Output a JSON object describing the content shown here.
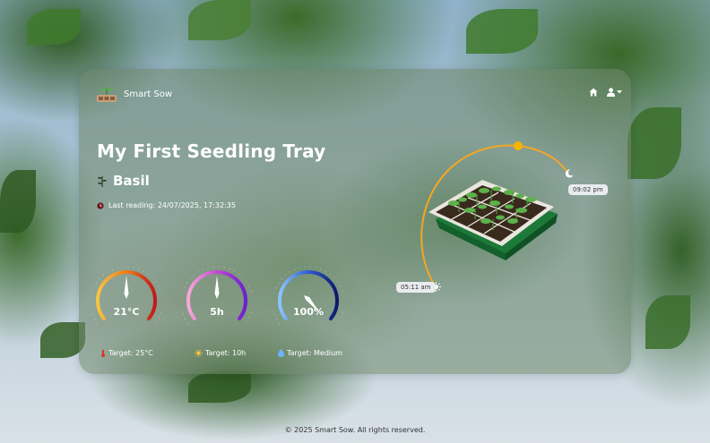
{
  "brand": {
    "name": "Smart Sow"
  },
  "nav": {
    "home_icon": "home-icon",
    "user_icon": "user-icon"
  },
  "tray": {
    "title": "My First Seedling Tray",
    "plant": "Basil",
    "last_reading": "Last reading: 24/07/2025, 17:32:35"
  },
  "gauges": [
    {
      "name": "temperature",
      "value": "21°C",
      "target": "Target: 25°C",
      "colors": [
        "#f5c542",
        "#f07c1a",
        "#c0191b"
      ]
    },
    {
      "name": "light",
      "value": "5h",
      "target": "Target: 10h",
      "colors": [
        "#f7a8d8",
        "#c14ad0",
        "#6a1fd0"
      ]
    },
    {
      "name": "humidity",
      "value": "100%",
      "target": "Target: Medium",
      "colors": [
        "#8ec5ff",
        "#2f5bd3",
        "#0d1a6b"
      ]
    }
  ],
  "sun_arc": {
    "sunrise": "05:11 am",
    "sunset": "09:02 pm",
    "arc_color": "#f5a623"
  },
  "footer": {
    "text": "© 2025 Smart Sow. All rights reserved."
  }
}
